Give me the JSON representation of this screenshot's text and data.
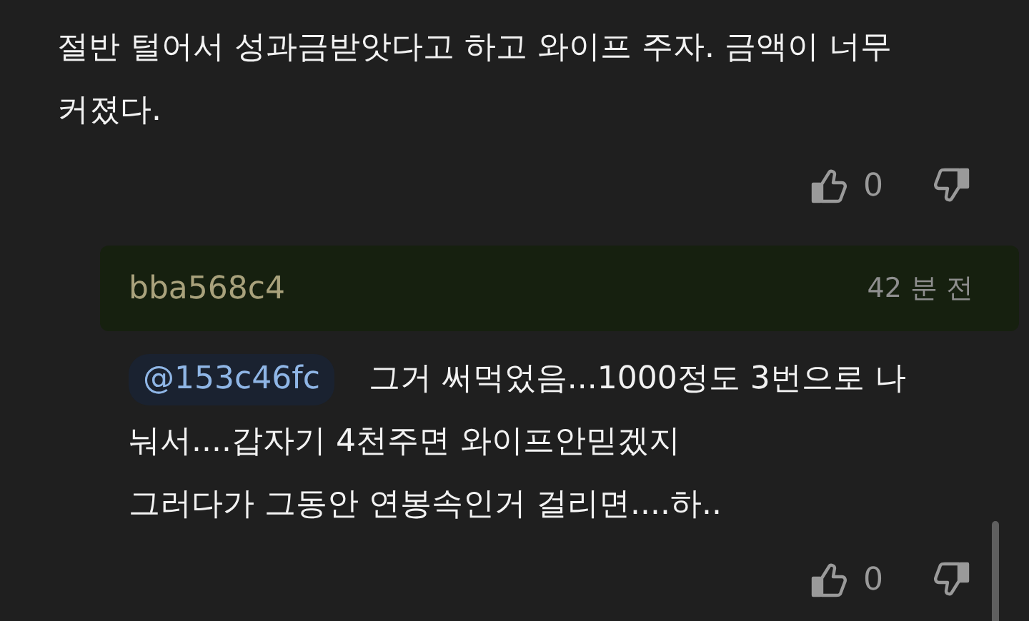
{
  "comment": {
    "lines": [
      "절반 털어서 성과금받앗다고 하고 와이프 주자. 금액이 너무",
      "커졌다."
    ],
    "likes": "0"
  },
  "reply": {
    "author": "bba568c4",
    "time": "42 분 전",
    "mention": "@153c46fc",
    "lines": [
      "그거 써먹었음...1000정도 3번으로 나",
      "눠서....갑자기 4천주면 와이프안믿겠지",
      "그러다가 그동안 연봉속인거 걸리면....하.."
    ],
    "likes": "0"
  }
}
